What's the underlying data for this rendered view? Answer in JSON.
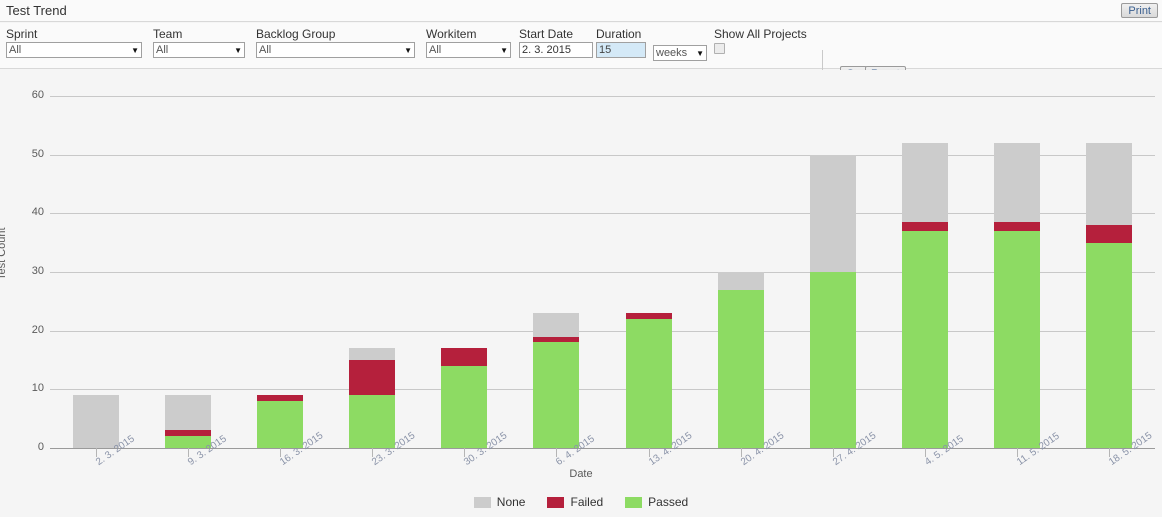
{
  "header": {
    "title": "Test Trend",
    "print_label": "Print"
  },
  "filters": {
    "sprint": {
      "label": "Sprint",
      "value": "All",
      "caret": "chevron-down-icon"
    },
    "team": {
      "label": "Team",
      "value": "All",
      "caret": "chevron-down-icon"
    },
    "backlog_group": {
      "label": "Backlog Group",
      "value": "All",
      "caret": "chevron-down-icon"
    },
    "workitem": {
      "label": "Workitem",
      "value": "All",
      "caret": "chevron-down-icon"
    },
    "start_date": {
      "label": "Start Date",
      "value": "2. 3. 2015"
    },
    "duration": {
      "label": "Duration",
      "value": "15"
    },
    "duration_unit": {
      "value": "weeks",
      "caret": "chevron-down-icon"
    },
    "show_all_projects": {
      "label": "Show All Projects",
      "checked": false
    },
    "go_label": "Go",
    "reset_label": "Reset"
  },
  "chart_data": {
    "type": "bar",
    "stacked": true,
    "title": "",
    "xlabel": "Date",
    "ylabel": "Test Count",
    "ylim": [
      0,
      60
    ],
    "yticks": [
      0,
      10,
      20,
      30,
      40,
      50,
      60
    ],
    "grid": true,
    "legend_position": "bottom",
    "categories": [
      "2. 3. 2015",
      "9. 3. 2015",
      "16. 3. 2015",
      "23. 3. 2015",
      "30. 3. 2015",
      "6. 4. 2015",
      "13. 4. 2015",
      "20. 4. 2015",
      "27. 4. 2015",
      "4. 5. 2015",
      "11. 5. 2015",
      "18. 5. 2015"
    ],
    "series": [
      {
        "name": "Passed",
        "color": "#8ddb63",
        "values": [
          0,
          2,
          8,
          9,
          14,
          18,
          22,
          27,
          30,
          37,
          37,
          35
        ]
      },
      {
        "name": "Failed",
        "color": "#b5203c",
        "values": [
          0,
          1,
          1,
          6,
          3,
          1,
          1,
          0,
          0,
          1.5,
          1.5,
          3
        ]
      },
      {
        "name": "None",
        "color": "#cccccc",
        "values": [
          9,
          6,
          0,
          2,
          0,
          4,
          0,
          3,
          20,
          13.5,
          13.5,
          14
        ]
      }
    ],
    "totals": [
      9,
      9,
      9,
      17,
      17,
      23,
      23,
      30,
      50,
      52,
      52,
      52
    ]
  }
}
